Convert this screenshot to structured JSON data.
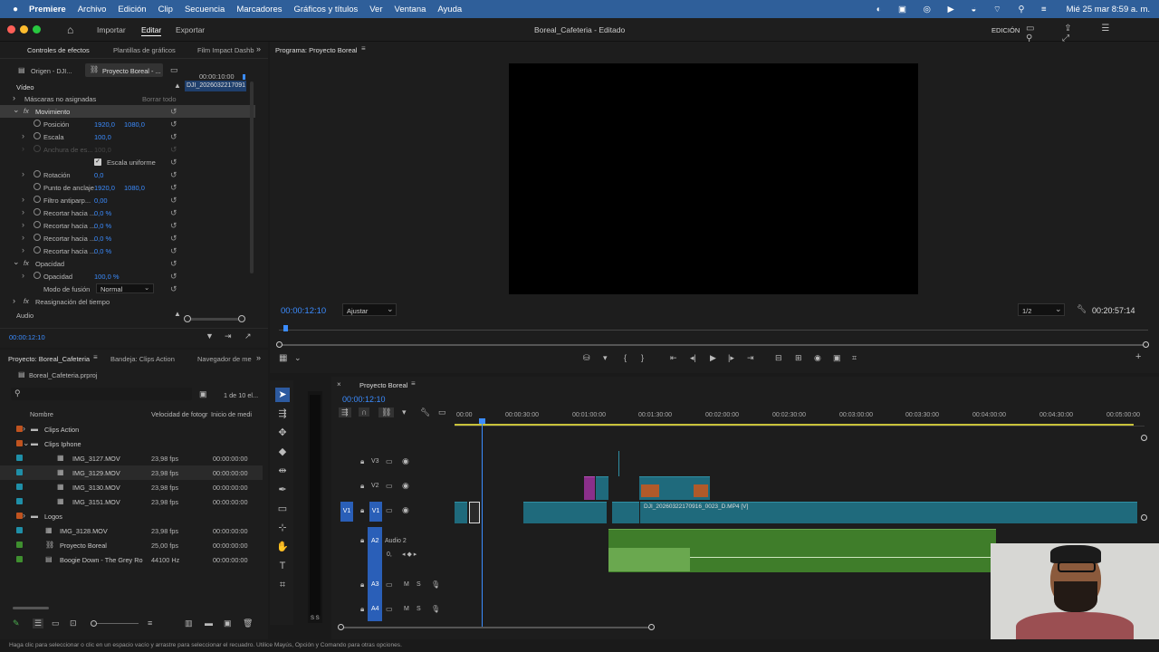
{
  "menubar": {
    "app": "Premiere",
    "items": [
      "Archivo",
      "Edición",
      "Clip",
      "Secuencia",
      "Marcadores",
      "Gráficos y títulos",
      "Ver",
      "Ventana",
      "Ayuda"
    ],
    "datetime": "Mié 25 mar 8:59 a. m."
  },
  "titlebar": {
    "tabs": [
      "Importar",
      "Editar",
      "Exportar"
    ],
    "active_tab": "Editar",
    "title": "Boreal_Cafeteria - Editado",
    "workspace": "EDICIÓN"
  },
  "effects_panel": {
    "tabs": [
      "Controles de efectos",
      "Plantillas de gráficos",
      "Film Impact Dashb"
    ],
    "source_tabs": [
      "Origen - DJI...",
      "Proyecto Boreal - ..."
    ],
    "mini_timecode": "00:00:10:00",
    "mini_clip": "DJI_2026032217091",
    "section_video": "Vídeo",
    "masks": "Máscaras no asignadas",
    "clear_all": "Borrar todo",
    "movement": "Movimiento",
    "position_label": "Posición",
    "position_x": "1920,0",
    "position_y": "1080,0",
    "scale_label": "Escala",
    "scale_value": "100,0",
    "scale_width_label": "Anchura de es...",
    "scale_width_value": "100,0",
    "uniform_scale": "Escala uniforme",
    "rotation_label": "Rotación",
    "rotation_value": "0,0",
    "anchor_label": "Punto de anclaje",
    "anchor_x": "1920,0",
    "anchor_y": "1080,0",
    "antiflicker_label": "Filtro antiparp...",
    "antiflicker_value": "0,00",
    "crop_label": "Recortar hacia ...",
    "crop_value": "0,0 %",
    "opacity_section": "Opacidad",
    "opacity_label": "Opacidad",
    "opacity_value": "100,0 %",
    "blend_label": "Modo de fusión",
    "blend_value": "Normal",
    "time_remap": "Reasignación del tiempo",
    "audio": "Audio",
    "timecode": "00:00:12:10"
  },
  "program_monitor": {
    "title": "Programa: Proyecto Boreal",
    "timecode": "00:00:12:10",
    "fit": "Ajustar",
    "resolution": "1/2",
    "duration": "00:20:57:14"
  },
  "project_panel": {
    "tabs": [
      "Proyecto: Boreal_Cafeteria",
      "Bandeja: Clips Action",
      "Navegador de me"
    ],
    "file": "Boreal_Cafeteria.prproj",
    "count": "1 de 10 el...",
    "headers": [
      "Nombre",
      "Velocidad de fotogr",
      "Inicio de medi"
    ],
    "items": [
      {
        "name": "Clips Action",
        "fps": "",
        "start": "",
        "color": "#c0531f",
        "type": "bin"
      },
      {
        "name": "Clips Iphone",
        "fps": "",
        "start": "",
        "color": "#c0531f",
        "type": "bin"
      },
      {
        "name": "IMG_3127.MOV",
        "fps": "23,98 fps",
        "start": "00:00:00:00",
        "color": "#1f8fa8",
        "type": "clip"
      },
      {
        "name": "IMG_3129.MOV",
        "fps": "23,98 fps",
        "start": "00:00:00:00",
        "color": "#1f8fa8",
        "type": "clip"
      },
      {
        "name": "IMG_3130.MOV",
        "fps": "23,98 fps",
        "start": "00:00:00:00",
        "color": "#1f8fa8",
        "type": "clip"
      },
      {
        "name": "IMG_3151.MOV",
        "fps": "23,98 fps",
        "start": "00:00:00:00",
        "color": "#1f8fa8",
        "type": "clip"
      },
      {
        "name": "Logos",
        "fps": "",
        "start": "",
        "color": "#c0531f",
        "type": "bin"
      },
      {
        "name": "IMG_3128.MOV",
        "fps": "23,98 fps",
        "start": "00:00:00:00",
        "color": "#1f8fa8",
        "type": "clip"
      },
      {
        "name": "Proyecto Boreal",
        "fps": "25,00 fps",
        "start": "00:00:00:00",
        "color": "#3f8f2f",
        "type": "seq"
      },
      {
        "name": "Boogie Down - The Grey Ro",
        "fps": "44100 Hz",
        "start": "00:00:00:00",
        "color": "#3f8f2f",
        "type": "audio"
      }
    ]
  },
  "timeline": {
    "title": "Proyecto Boreal",
    "timecode": "00:00:12:10",
    "ruler": [
      "00:00",
      "00:00:30:00",
      "00:01:00:00",
      "00:01:30:00",
      "00:02:00:00",
      "00:02:30:00",
      "00:03:00:00",
      "00:03:30:00",
      "00:04:00:00",
      "00:04:30:00",
      "00:05:00:00"
    ],
    "tracks": [
      "V3",
      "V2",
      "V1",
      "A2",
      "A3",
      "A4"
    ],
    "audio2_label": "Audio 2",
    "audio2_vol": "0,",
    "clip_name": "DJI_20260322170916_0023_D.MP4 [V]",
    "m": "M",
    "s": "S"
  },
  "statusbar": {
    "text": "Haga clic para seleccionar o clic en un espacio vacío y arrastre para seleccionar el recuadro. Utilice Mayús, Opción y Comando para otras opciones."
  }
}
